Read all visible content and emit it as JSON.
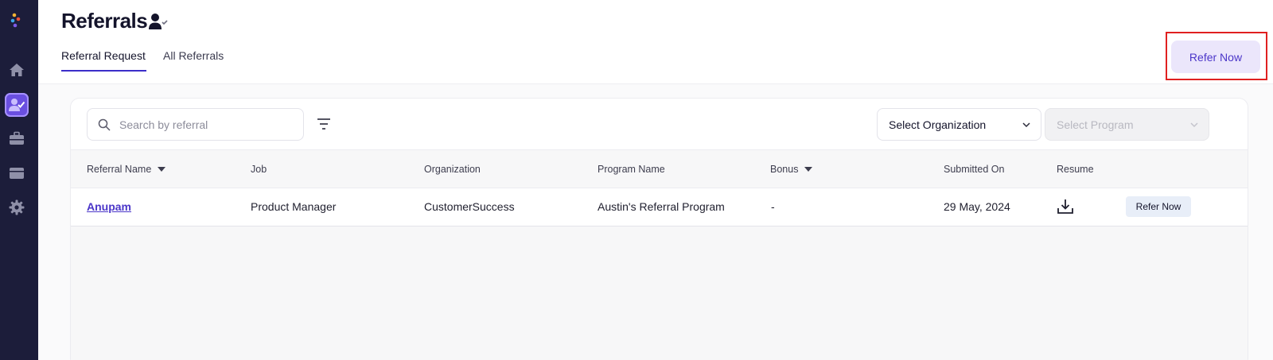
{
  "page": {
    "title": "Referrals",
    "tabs": [
      {
        "label": "Referral Request",
        "active": true
      },
      {
        "label": "All Referrals",
        "active": false
      }
    ],
    "refer_now_label": "Refer Now"
  },
  "sidebar": {
    "items": [
      {
        "icon": "home-icon",
        "active": false
      },
      {
        "icon": "referrals-icon",
        "active": true
      },
      {
        "icon": "briefcase-icon",
        "active": false
      },
      {
        "icon": "wallet-icon",
        "active": false
      },
      {
        "icon": "settings-icon",
        "active": false
      }
    ]
  },
  "toolbar": {
    "search_placeholder": "Search by referral",
    "organization_select": "Select Organization",
    "program_select": "Select Program"
  },
  "table": {
    "columns": [
      "Referral Name",
      "Job",
      "Organization",
      "Program Name",
      "Bonus",
      "Submitted On",
      "Resume"
    ],
    "rows": [
      {
        "referral_name": "Anupam",
        "job": "Product Manager",
        "organization": "CustomerSuccess",
        "program_name": "Austin's Referral Program",
        "bonus": "-",
        "submitted_on": "29 May, 2024",
        "action_label": "Refer Now"
      }
    ]
  },
  "colors": {
    "sidebar_bg": "#1c1d3a",
    "accent": "#4b36c9",
    "accent_light": "#ebe6fb",
    "highlight_box": "#e02020"
  }
}
